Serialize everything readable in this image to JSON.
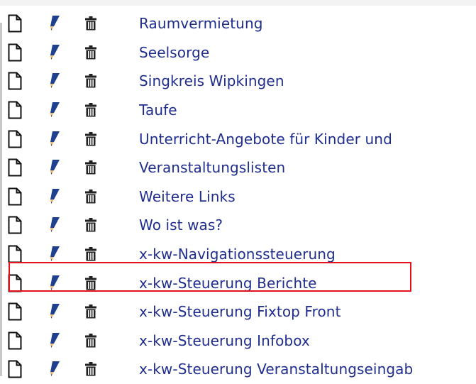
{
  "rows": [
    {
      "label": "Raumvermietung"
    },
    {
      "label": "Seelsorge"
    },
    {
      "label": "Singkreis Wipkingen"
    },
    {
      "label": "Taufe"
    },
    {
      "label": "Unterricht-Angebote für Kinder und"
    },
    {
      "label": "Veranstaltungslisten"
    },
    {
      "label": "Weitere Links"
    },
    {
      "label": "Wo ist was?"
    },
    {
      "label": "x-kw-Navigationssteuerung"
    },
    {
      "label": "x-kw-Steuerung Berichte",
      "highlighted": true
    },
    {
      "label": "x-kw-Steuerung Fixtop Front"
    },
    {
      "label": "x-kw-Steuerung Infobox"
    },
    {
      "label": "x-kw-Steuerung Veranstaltungseingab"
    }
  ],
  "icons": {
    "view": "document-icon",
    "edit": "pencil-icon",
    "delete": "trash-icon"
  },
  "colors": {
    "link": "#1f2d8f",
    "highlight": "#e5121b",
    "pencil_blue": "#1f3f8f",
    "pencil_tip": "#e8b878"
  }
}
